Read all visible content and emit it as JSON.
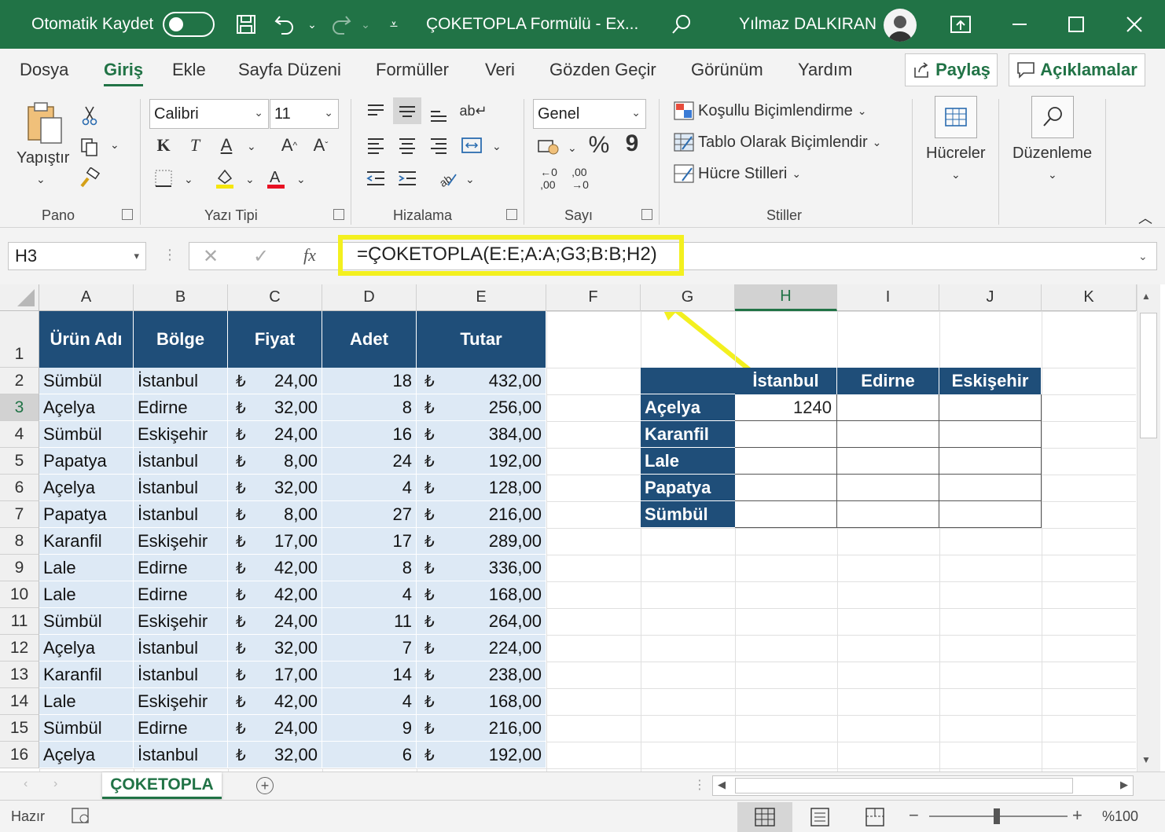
{
  "titlebar": {
    "autosave_label": "Otomatik Kaydet",
    "doc_title": "ÇOKETOPLA Formülü  -  Ex...",
    "user_name": "Yılmaz DALKIRAN"
  },
  "ribbon_tabs": [
    "Dosya",
    "Giriş",
    "Ekle",
    "Sayfa Düzeni",
    "Formüller",
    "Veri",
    "Gözden Geçir",
    "Görünüm",
    "Yardım"
  ],
  "share_label": "Paylaş",
  "comments_label": "Açıklamalar",
  "clipboard": {
    "paste_label": "Yapıştır",
    "group": "Pano"
  },
  "font": {
    "name": "Calibri",
    "size": "11",
    "group": "Yazı Tipi",
    "bold": "K",
    "italic": "T",
    "underline": "A"
  },
  "alignment": {
    "group": "Hizalama"
  },
  "number": {
    "format": "Genel",
    "group": "Sayı",
    "percent": "%",
    "comma": "9"
  },
  "styles": {
    "conditional": "Koşullu Biçimlendirme",
    "as_table": "Tablo Olarak Biçimlendir",
    "cell_styles": "Hücre Stilleri",
    "group": "Stiller"
  },
  "cells_label": "Hücreler",
  "editing_label": "Düzenleme",
  "formula_bar": {
    "name_box": "H3",
    "fx": "fx",
    "formula": "=ÇOKETOPLA(E:E;A:A;G3;B:B;H2)"
  },
  "columns": [
    "A",
    "B",
    "C",
    "D",
    "E",
    "F",
    "G",
    "H",
    "I",
    "J",
    "K"
  ],
  "rows": [
    "1",
    "2",
    "3",
    "4",
    "5",
    "6",
    "7",
    "8",
    "9",
    "10",
    "11",
    "12",
    "13",
    "14",
    "15",
    "16"
  ],
  "table": {
    "headers": [
      "Ürün Adı",
      "Bölge",
      "Fiyat",
      "Adet",
      "Tutar"
    ],
    "currency": "₺",
    "rows": [
      [
        "Sümbül",
        "İstanbul",
        "24,00",
        "18",
        "432,00"
      ],
      [
        "Açelya",
        "Edirne",
        "32,00",
        "8",
        "256,00"
      ],
      [
        "Sümbül",
        "Eskişehir",
        "24,00",
        "16",
        "384,00"
      ],
      [
        "Papatya",
        "İstanbul",
        "8,00",
        "24",
        "192,00"
      ],
      [
        "Açelya",
        "İstanbul",
        "32,00",
        "4",
        "128,00"
      ],
      [
        "Papatya",
        "İstanbul",
        "8,00",
        "27",
        "216,00"
      ],
      [
        "Karanfil",
        "Eskişehir",
        "17,00",
        "17",
        "289,00"
      ],
      [
        "Lale",
        "Edirne",
        "42,00",
        "8",
        "336,00"
      ],
      [
        "Lale",
        "Edirne",
        "42,00",
        "4",
        "168,00"
      ],
      [
        "Sümbül",
        "Eskişehir",
        "24,00",
        "11",
        "264,00"
      ],
      [
        "Açelya",
        "İstanbul",
        "32,00",
        "7",
        "224,00"
      ],
      [
        "Karanfil",
        "İstanbul",
        "17,00",
        "14",
        "238,00"
      ],
      [
        "Lale",
        "Eskişehir",
        "42,00",
        "4",
        "168,00"
      ],
      [
        "Sümbül",
        "Edirne",
        "24,00",
        "9",
        "216,00"
      ],
      [
        "Açelya",
        "İstanbul",
        "32,00",
        "6",
        "192,00"
      ]
    ]
  },
  "summary": {
    "regions": [
      "İstanbul",
      "Edirne",
      "Eskişehir"
    ],
    "products": [
      "Açelya",
      "Karanfil",
      "Lale",
      "Papatya",
      "Sümbül"
    ],
    "h3_value": "1240"
  },
  "sheet_tab": "ÇOKETOPLA",
  "status": {
    "ready": "Hazır",
    "zoom": "%100"
  },
  "colors": {
    "excel_green": "#217346",
    "header_blue": "#1f4e79",
    "row_fill": "#dde9f5",
    "highlight": "#f3f01f"
  }
}
